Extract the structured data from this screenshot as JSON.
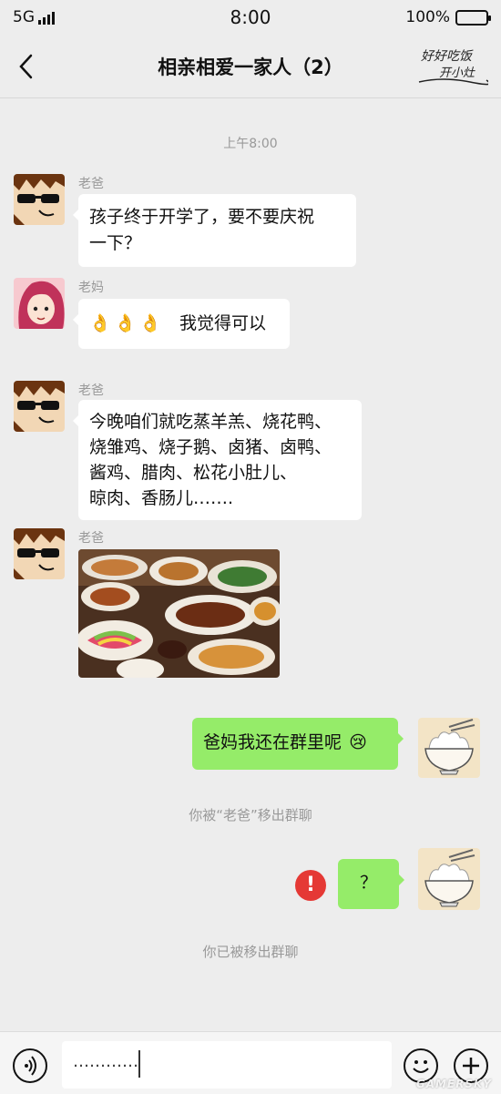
{
  "status_bar": {
    "network": "5G",
    "time": "8:00",
    "battery": "100%"
  },
  "header": {
    "title": "相亲相爱一家人（2）",
    "logo_text": "好好吃饭 开小灶"
  },
  "chat": {
    "time_divider": "上午8:00",
    "messages": [
      {
        "sender": "老爸",
        "text_lines": [
          "孩子终于开学了，要不要庆祝",
          "一下？"
        ],
        "avatar": "dad-sunglasses-avatar"
      },
      {
        "sender": "老妈",
        "text": "我觉得可以",
        "emoji": "👌👌👌",
        "avatar": "mom-avatar"
      },
      {
        "sender": "老爸",
        "text_lines": [
          "今晚咱们就吃蒸羊羔、烧花鸭、",
          "烧雏鸡、烧子鹅、卤猪、卤鸭、",
          "酱鸡、腊肉、松花小肚儿、",
          "晾肉、香肠儿……."
        ],
        "avatar": "dad-sunglasses-avatar"
      },
      {
        "sender": "老爸",
        "image": "food-feast-photo",
        "avatar": "dad-sunglasses-avatar"
      },
      {
        "self": true,
        "text": "爸妈我还在群里呢",
        "emoji": "😢",
        "avatar": "rice-bowl-avatar"
      },
      {
        "system": true,
        "text": "你被“老爸”移出群聊"
      },
      {
        "self": true,
        "text": "？",
        "failed": true,
        "avatar": "rice-bowl-avatar"
      },
      {
        "system": true,
        "text": "你已被移出群聊"
      }
    ]
  },
  "input_bar": {
    "value": "…………"
  },
  "watermark": "GAMERSKY",
  "colors": {
    "background": "#ededed",
    "self_bubble": "#95ec69",
    "other_bubble": "#ffffff",
    "error": "#e53935"
  }
}
